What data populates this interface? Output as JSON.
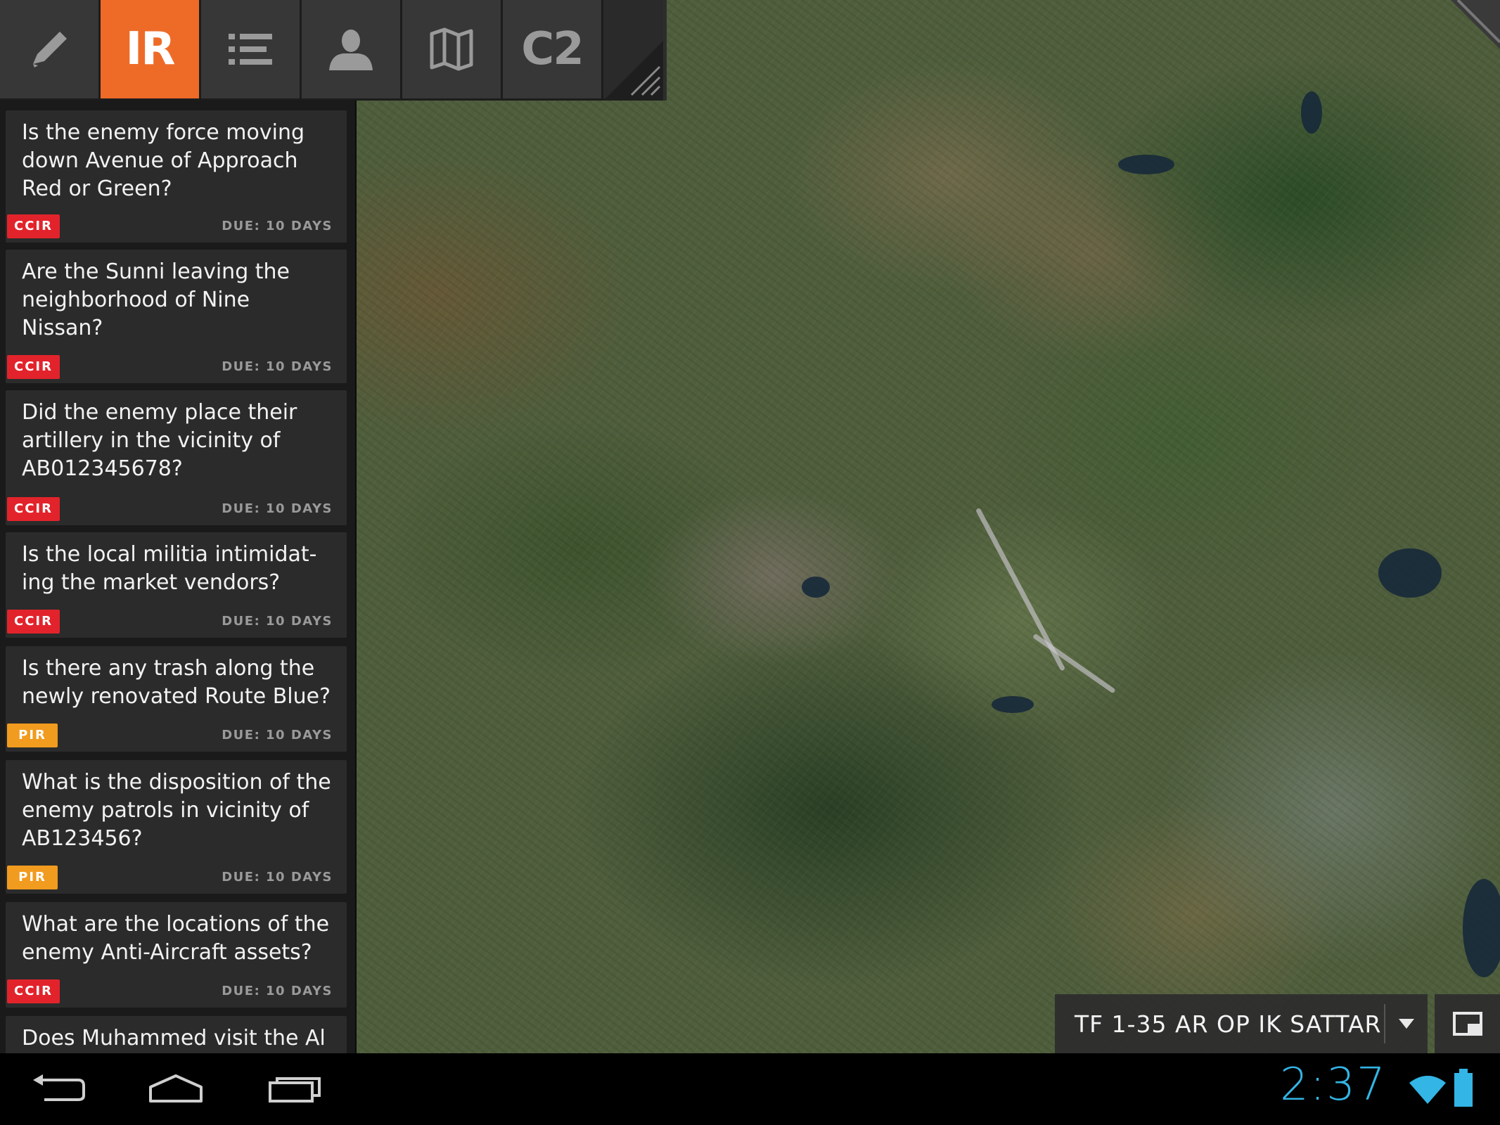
{
  "tabs": [
    {
      "id": "edit",
      "icon": "pencil-icon",
      "label": ""
    },
    {
      "id": "ir",
      "icon": "",
      "label": "IR",
      "active": true
    },
    {
      "id": "list",
      "icon": "list-icon",
      "label": ""
    },
    {
      "id": "person",
      "icon": "person-icon",
      "label": ""
    },
    {
      "id": "map",
      "icon": "map-icon",
      "label": ""
    },
    {
      "id": "c2",
      "icon": "",
      "label": "C2"
    }
  ],
  "requirements": [
    {
      "question": "Is the enemy force moving down Avenue of Approach Red or Green?",
      "type": "CCIR",
      "due": "DUE: 10 DAYS"
    },
    {
      "question": "Are the Sunni leaving the neighborhood of Nine Nissan?",
      "type": "CCIR",
      "due": "DUE: 10 DAYS"
    },
    {
      "question": "Did the enemy place their artillery in the vicinity of AB012345678?",
      "type": "CCIR",
      "due": "DUE: 10 DAYS"
    },
    {
      "question": "Is the local militia intimidat-ing the market vendors?",
      "type": "CCIR",
      "due": "DUE: 10 DAYS"
    },
    {
      "question": "Is there any trash along the newly renovated Route Blue?",
      "type": "PIR",
      "due": "DUE: 10 DAYS"
    },
    {
      "question": "What is the disposition of the enemy patrols in vicinity of AB123456?",
      "type": "PIR",
      "due": "DUE: 10 DAYS"
    },
    {
      "question": "What are the locations of the enemy Anti-Aircraft assets?",
      "type": "CCIR",
      "due": "DUE: 10 DAYS"
    },
    {
      "question": "Does Muhammed visit the Al",
      "type": "",
      "due": ""
    }
  ],
  "operation": {
    "label": "TF 1-35 AR OP IK SATTAR"
  },
  "status": {
    "time": "2:37"
  },
  "colors": {
    "accent": "#ee6b27",
    "ccir": "#e2232b",
    "pir": "#f19b1f",
    "clock": "#33b5e5"
  }
}
